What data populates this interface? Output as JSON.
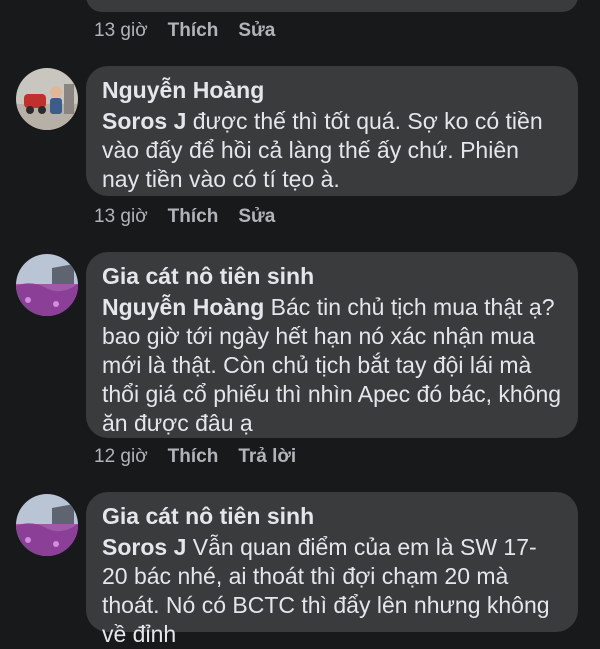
{
  "comments": [
    {
      "time": "13 giờ",
      "actions": [
        "Thích",
        "Sửa"
      ]
    },
    {
      "author": "Nguyễn Hoàng",
      "mention": "Soros J",
      "text": " được thế thì tốt quá. Sợ ko có tiền vào đấy để hồi cả làng thế ấy chứ. Phiên nay tiền vào có tí tẹo à.",
      "time": "13 giờ",
      "actions": [
        "Thích",
        "Sửa"
      ]
    },
    {
      "author": "Gia cát nô tiên sinh",
      "mention": "Nguyễn Hoàng",
      "text": " Bác tin chủ tịch mua thật ạ? bao giờ tới ngày hết hạn nó xác nhận mua mới là thật. Còn chủ tịch bắt tay đội lái mà thổi giá cổ phiếu thì nhìn Apec đó bác, không ăn được đâu ạ",
      "time": "12 giờ",
      "actions": [
        "Thích",
        "Trả lời"
      ]
    },
    {
      "author": "Gia cát nô tiên sinh",
      "mention": "Soros J",
      "text": " Vẫn quan điểm của em là SW 17-20 bác nhé, ai thoát thì đợi chạm 20 mà thoát. Nó có BCTC thì đẩy lên nhưng không về đỉnh"
    }
  ]
}
